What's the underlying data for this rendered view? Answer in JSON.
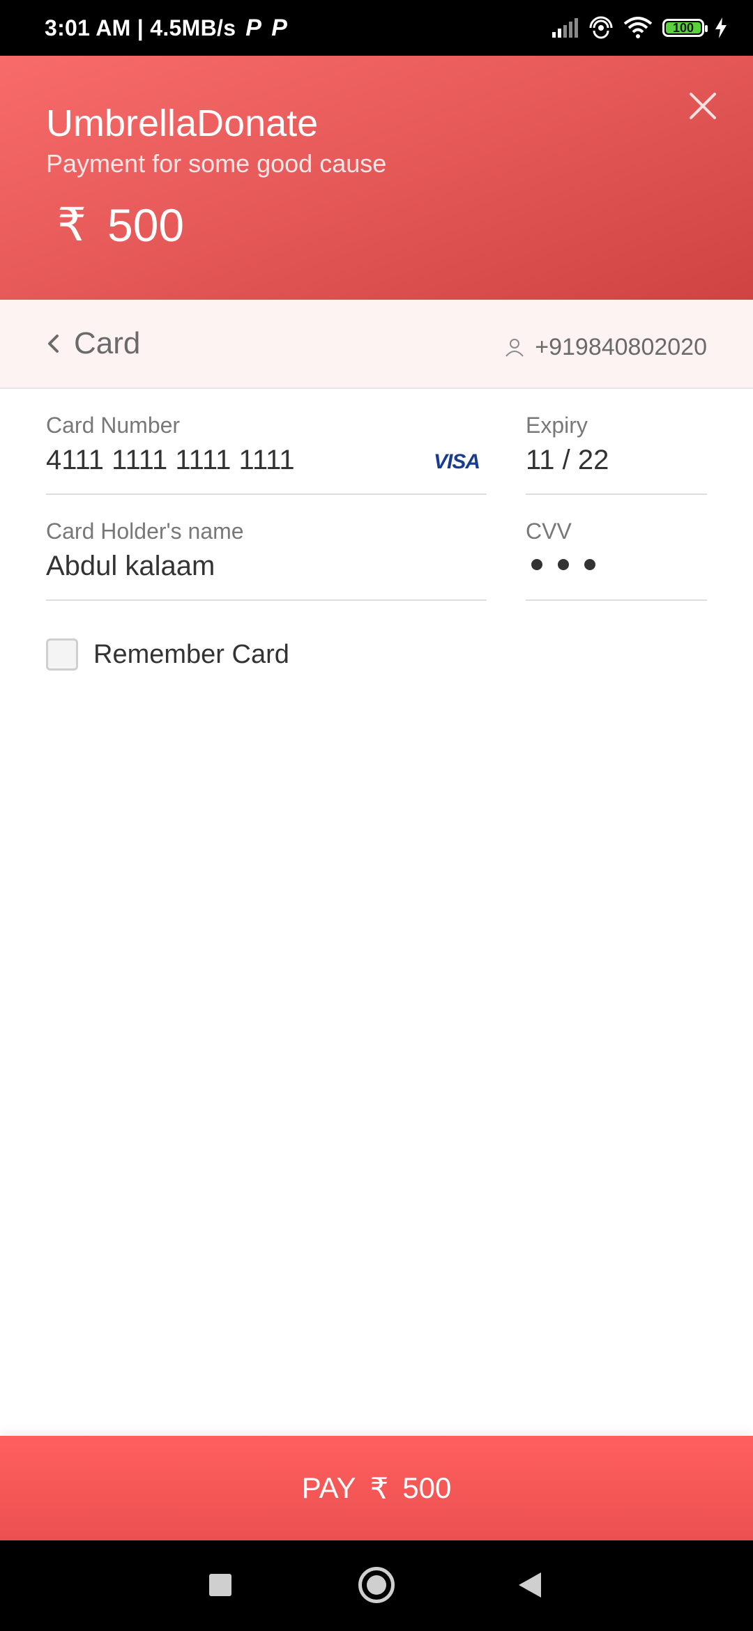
{
  "status_bar": {
    "time_speed": "3:01 AM | 4.5MB/s",
    "p_icons": [
      "P",
      "P"
    ],
    "battery_level": "100"
  },
  "header": {
    "title": "UmbrellaDonate",
    "subtitle": "Payment for some good cause",
    "currency_symbol": "₹",
    "amount": "500"
  },
  "method_bar": {
    "title": "Card",
    "contact_phone": "+919840802020"
  },
  "form": {
    "card_number_label": "Card Number",
    "card_number_value": "4111 1111 1111 1111",
    "card_brand": "VISA",
    "expiry_label": "Expiry",
    "expiry_value": "11 / 22",
    "holder_label": "Card Holder's name",
    "holder_value": "Abdul kalaam",
    "cvv_label": "CVV",
    "remember_label": "Remember Card",
    "remember_checked": false
  },
  "pay_button": {
    "label": "PAY",
    "currency_symbol": "₹",
    "amount": "500"
  },
  "colors": {
    "brand": "#e75a5a",
    "pay": "#f55858",
    "visa": "#1a3c8f"
  }
}
